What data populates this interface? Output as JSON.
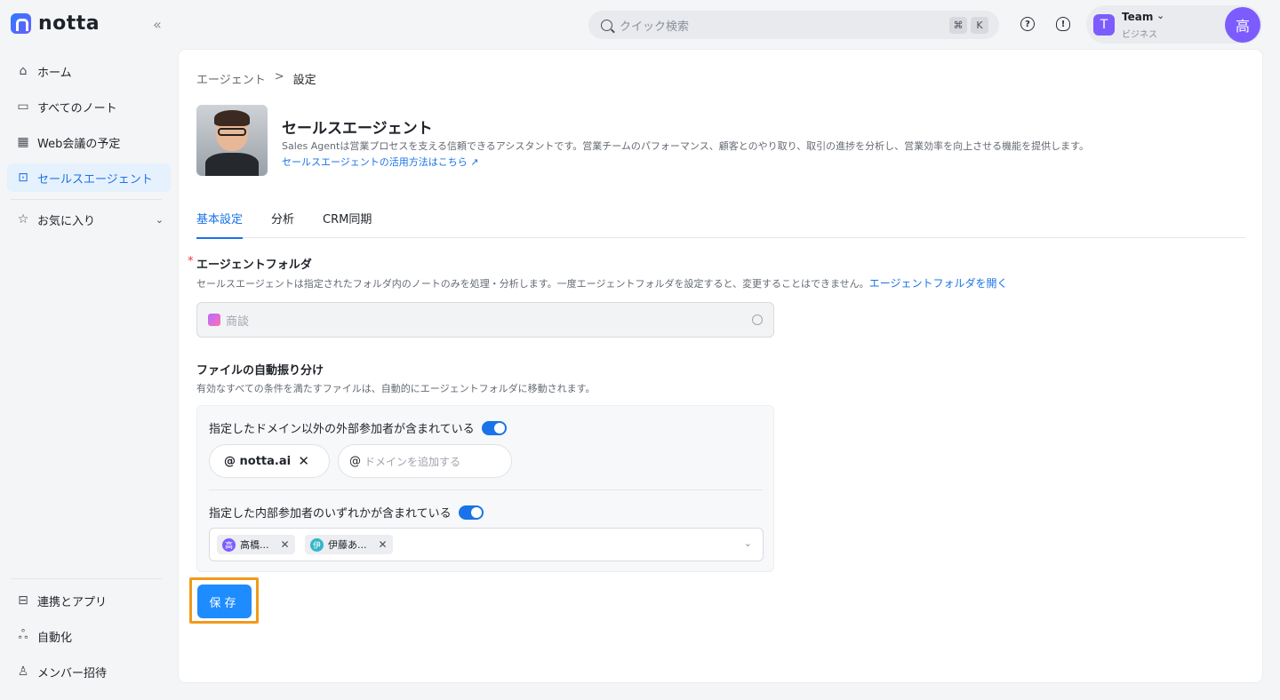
{
  "app": {
    "logo_text": "notta"
  },
  "sidebar": {
    "items": [
      {
        "label": "ホーム",
        "icon": "home-icon"
      },
      {
        "label": "すべてのノート",
        "icon": "folder-icon"
      },
      {
        "label": "Web会議の予定",
        "icon": "calendar-icon"
      },
      {
        "label": "セールスエージェント",
        "icon": "robot-icon",
        "active": true
      },
      {
        "label": "お気に入り",
        "icon": "star-icon"
      }
    ],
    "bottom_items": [
      {
        "label": "連携とアプリ",
        "icon": "briefcase-icon"
      },
      {
        "label": "自動化",
        "icon": "automation-icon"
      },
      {
        "label": "メンバー招待",
        "icon": "add-member-icon"
      }
    ]
  },
  "topbar": {
    "search_placeholder": "クイック検索",
    "kbd_cmd": "⌘",
    "kbd_key": "K",
    "team": {
      "badge": "T",
      "name": "Team",
      "plan": "ビジネス"
    },
    "avatar": "高"
  },
  "main": {
    "breadcrumb": {
      "parent": "エージェント",
      "sep": ">",
      "current": "設定"
    },
    "agent": {
      "title": "セールスエージェント",
      "description": "Sales Agentは営業プロセスを支える信頼できるアシスタントです。営業チームのパフォーマンス、顧客とのやり取り、取引の進捗を分析し、営業効率を向上させる機能を提供します。",
      "link": "セールスエージェントの活用方法はこちら ↗"
    },
    "tabs": [
      "基本設定",
      "分析",
      "CRM同期"
    ],
    "folder_section": {
      "required_mark": "*",
      "title": "エージェントフォルダ",
      "description": "セールスエージェントは指定されたフォルダ内のノートのみを処理・分析します。一度エージェントフォルダを設定すると、変更することはできません。",
      "link": "エージェントフォルダを開く",
      "input_placeholder": "商談"
    },
    "auto_section": {
      "title": "ファイルの自動振り分け",
      "description": "有効なすべての条件を満たすファイルは、自動的にエージェントフォルダに移動されます。",
      "rule1": {
        "label": "指定したドメイン以外の外部参加者が含まれている",
        "enabled": true,
        "domain_chip": "@ notta.ai",
        "domain_input_at": "@",
        "domain_input_placeholder": "ドメインを追加する"
      },
      "rule2": {
        "label": "指定した内部参加者のいずれかが含まれている",
        "enabled": true,
        "members": [
          {
            "avatar": "高",
            "name": "高橋...",
            "color": "#7c5cff"
          },
          {
            "avatar": "伊",
            "name": "伊藤あ...",
            "color": "#33b6c9"
          }
        ]
      }
    },
    "save_label": "保存"
  }
}
